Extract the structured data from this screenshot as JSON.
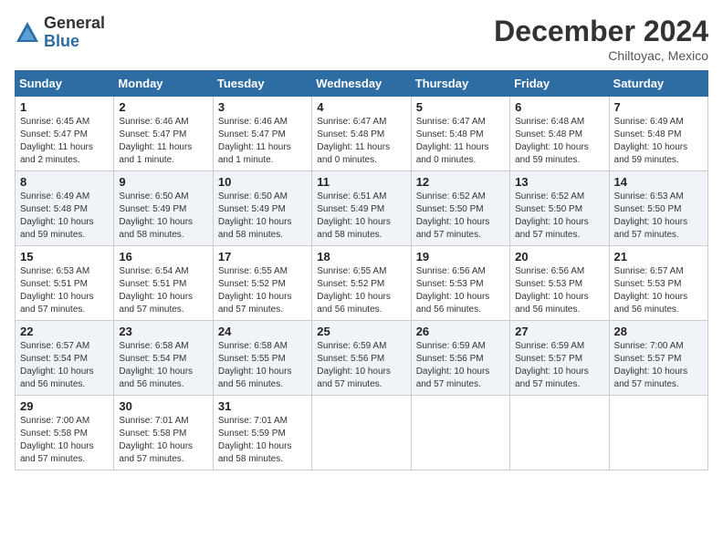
{
  "header": {
    "logo_general": "General",
    "logo_blue": "Blue",
    "title": "December 2024",
    "location": "Chiltoyac, Mexico"
  },
  "columns": [
    "Sunday",
    "Monday",
    "Tuesday",
    "Wednesday",
    "Thursday",
    "Friday",
    "Saturday"
  ],
  "weeks": [
    [
      {
        "day": "1",
        "info": "Sunrise: 6:45 AM\nSunset: 5:47 PM\nDaylight: 11 hours\nand 2 minutes."
      },
      {
        "day": "2",
        "info": "Sunrise: 6:46 AM\nSunset: 5:47 PM\nDaylight: 11 hours\nand 1 minute."
      },
      {
        "day": "3",
        "info": "Sunrise: 6:46 AM\nSunset: 5:47 PM\nDaylight: 11 hours\nand 1 minute."
      },
      {
        "day": "4",
        "info": "Sunrise: 6:47 AM\nSunset: 5:48 PM\nDaylight: 11 hours\nand 0 minutes."
      },
      {
        "day": "5",
        "info": "Sunrise: 6:47 AM\nSunset: 5:48 PM\nDaylight: 11 hours\nand 0 minutes."
      },
      {
        "day": "6",
        "info": "Sunrise: 6:48 AM\nSunset: 5:48 PM\nDaylight: 10 hours\nand 59 minutes."
      },
      {
        "day": "7",
        "info": "Sunrise: 6:49 AM\nSunset: 5:48 PM\nDaylight: 10 hours\nand 59 minutes."
      }
    ],
    [
      {
        "day": "8",
        "info": "Sunrise: 6:49 AM\nSunset: 5:48 PM\nDaylight: 10 hours\nand 59 minutes."
      },
      {
        "day": "9",
        "info": "Sunrise: 6:50 AM\nSunset: 5:49 PM\nDaylight: 10 hours\nand 58 minutes."
      },
      {
        "day": "10",
        "info": "Sunrise: 6:50 AM\nSunset: 5:49 PM\nDaylight: 10 hours\nand 58 minutes."
      },
      {
        "day": "11",
        "info": "Sunrise: 6:51 AM\nSunset: 5:49 PM\nDaylight: 10 hours\nand 58 minutes."
      },
      {
        "day": "12",
        "info": "Sunrise: 6:52 AM\nSunset: 5:50 PM\nDaylight: 10 hours\nand 57 minutes."
      },
      {
        "day": "13",
        "info": "Sunrise: 6:52 AM\nSunset: 5:50 PM\nDaylight: 10 hours\nand 57 minutes."
      },
      {
        "day": "14",
        "info": "Sunrise: 6:53 AM\nSunset: 5:50 PM\nDaylight: 10 hours\nand 57 minutes."
      }
    ],
    [
      {
        "day": "15",
        "info": "Sunrise: 6:53 AM\nSunset: 5:51 PM\nDaylight: 10 hours\nand 57 minutes."
      },
      {
        "day": "16",
        "info": "Sunrise: 6:54 AM\nSunset: 5:51 PM\nDaylight: 10 hours\nand 57 minutes."
      },
      {
        "day": "17",
        "info": "Sunrise: 6:55 AM\nSunset: 5:52 PM\nDaylight: 10 hours\nand 57 minutes."
      },
      {
        "day": "18",
        "info": "Sunrise: 6:55 AM\nSunset: 5:52 PM\nDaylight: 10 hours\nand 56 minutes."
      },
      {
        "day": "19",
        "info": "Sunrise: 6:56 AM\nSunset: 5:53 PM\nDaylight: 10 hours\nand 56 minutes."
      },
      {
        "day": "20",
        "info": "Sunrise: 6:56 AM\nSunset: 5:53 PM\nDaylight: 10 hours\nand 56 minutes."
      },
      {
        "day": "21",
        "info": "Sunrise: 6:57 AM\nSunset: 5:53 PM\nDaylight: 10 hours\nand 56 minutes."
      }
    ],
    [
      {
        "day": "22",
        "info": "Sunrise: 6:57 AM\nSunset: 5:54 PM\nDaylight: 10 hours\nand 56 minutes."
      },
      {
        "day": "23",
        "info": "Sunrise: 6:58 AM\nSunset: 5:54 PM\nDaylight: 10 hours\nand 56 minutes."
      },
      {
        "day": "24",
        "info": "Sunrise: 6:58 AM\nSunset: 5:55 PM\nDaylight: 10 hours\nand 56 minutes."
      },
      {
        "day": "25",
        "info": "Sunrise: 6:59 AM\nSunset: 5:56 PM\nDaylight: 10 hours\nand 57 minutes."
      },
      {
        "day": "26",
        "info": "Sunrise: 6:59 AM\nSunset: 5:56 PM\nDaylight: 10 hours\nand 57 minutes."
      },
      {
        "day": "27",
        "info": "Sunrise: 6:59 AM\nSunset: 5:57 PM\nDaylight: 10 hours\nand 57 minutes."
      },
      {
        "day": "28",
        "info": "Sunrise: 7:00 AM\nSunset: 5:57 PM\nDaylight: 10 hours\nand 57 minutes."
      }
    ],
    [
      {
        "day": "29",
        "info": "Sunrise: 7:00 AM\nSunset: 5:58 PM\nDaylight: 10 hours\nand 57 minutes."
      },
      {
        "day": "30",
        "info": "Sunrise: 7:01 AM\nSunset: 5:58 PM\nDaylight: 10 hours\nand 57 minutes."
      },
      {
        "day": "31",
        "info": "Sunrise: 7:01 AM\nSunset: 5:59 PM\nDaylight: 10 hours\nand 58 minutes."
      },
      {
        "day": "",
        "info": ""
      },
      {
        "day": "",
        "info": ""
      },
      {
        "day": "",
        "info": ""
      },
      {
        "day": "",
        "info": ""
      }
    ]
  ]
}
